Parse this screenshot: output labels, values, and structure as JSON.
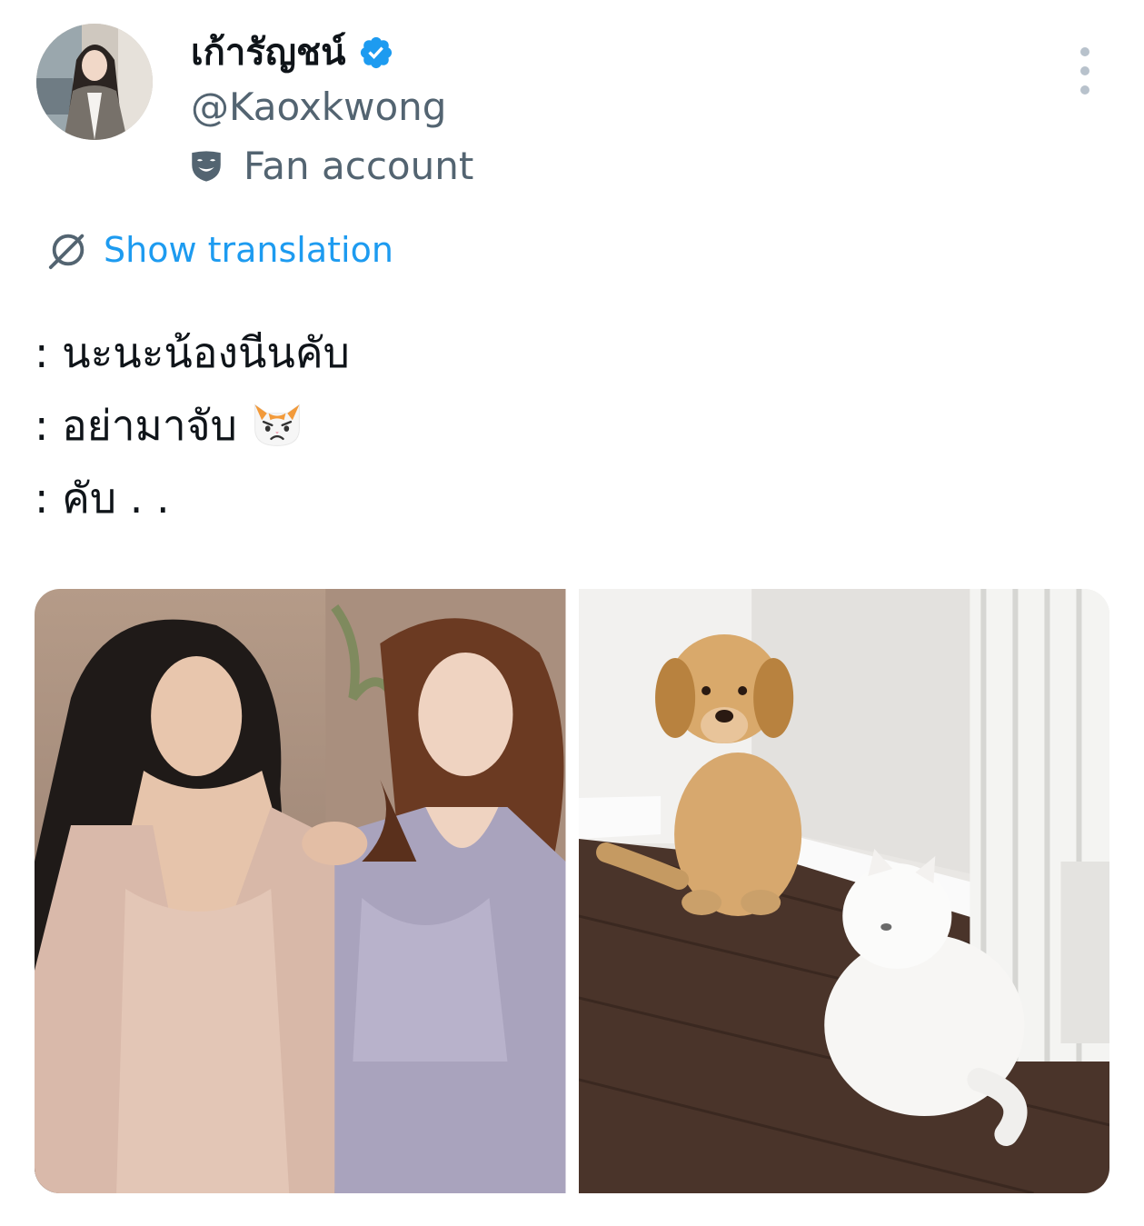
{
  "author": {
    "display_name": "เก้ารัญชน์",
    "handle": "@Kaoxkwong",
    "verified": true,
    "affiliation_label": "Fan account",
    "avatar_icon": "profile-photo"
  },
  "translation": {
    "label": "Show translation",
    "icon": "translate-icon"
  },
  "tweet": {
    "lines": [
      ": นะนะน้องนีนคับ",
      ": อย่ามาจับ",
      ": คับ . ."
    ],
    "emoji": "pouting-cat-face"
  },
  "media": {
    "photos": [
      {
        "subject": "two-women-in-robes"
      },
      {
        "subject": "puppy-and-white-cat"
      }
    ]
  },
  "colors": {
    "link": "#1d9bf0",
    "verified": "#1d9bf0",
    "secondary_text": "#536471",
    "primary_text": "#0f1419"
  }
}
